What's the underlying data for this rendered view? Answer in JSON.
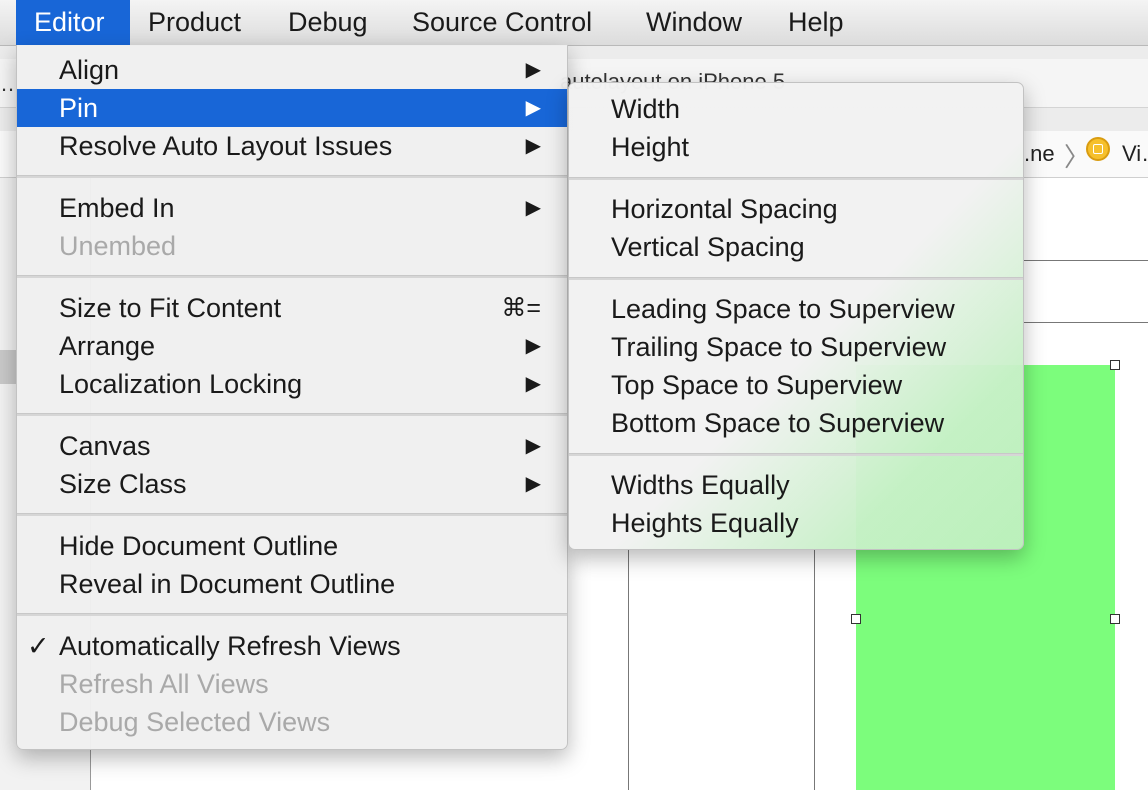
{
  "menubar": {
    "items": [
      "Editor",
      "Product",
      "Debug",
      "Source Control",
      "Window",
      "Help"
    ],
    "active": "Editor"
  },
  "background": {
    "toolbar_title": "autolayout on iPhone 5",
    "ellipsis": "…",
    "breadcrumb_tail": ".ne",
    "breadcrumb_next": "Vi…"
  },
  "editor_menu": {
    "align": "Align",
    "pin": "Pin",
    "resolve": "Resolve Auto Layout Issues",
    "embed_in": "Embed In",
    "unembed": "Unembed",
    "size_to_fit": "Size to Fit Content",
    "size_to_fit_shortcut": "⌘=",
    "arrange": "Arrange",
    "localization_locking": "Localization Locking",
    "canvas": "Canvas",
    "size_class": "Size Class",
    "hide_outline": "Hide Document Outline",
    "reveal_outline": "Reveal in Document Outline",
    "auto_refresh": "Automatically Refresh Views",
    "refresh_all": "Refresh All Views",
    "debug_selected": "Debug Selected Views",
    "submenu_arrow": "▶",
    "checkmark": "✓"
  },
  "pin_submenu": {
    "width": "Width",
    "height": "Height",
    "horizontal_spacing": "Horizontal Spacing",
    "vertical_spacing": "Vertical Spacing",
    "leading": "Leading Space to Superview",
    "trailing": "Trailing Space to Superview",
    "top": "Top Space to Superview",
    "bottom": "Bottom Space to Superview",
    "widths_equally": "Widths Equally",
    "heights_equally": "Heights Equally"
  },
  "colors": {
    "highlight": "#1866d7",
    "selected_view": "#7cfd7c"
  }
}
